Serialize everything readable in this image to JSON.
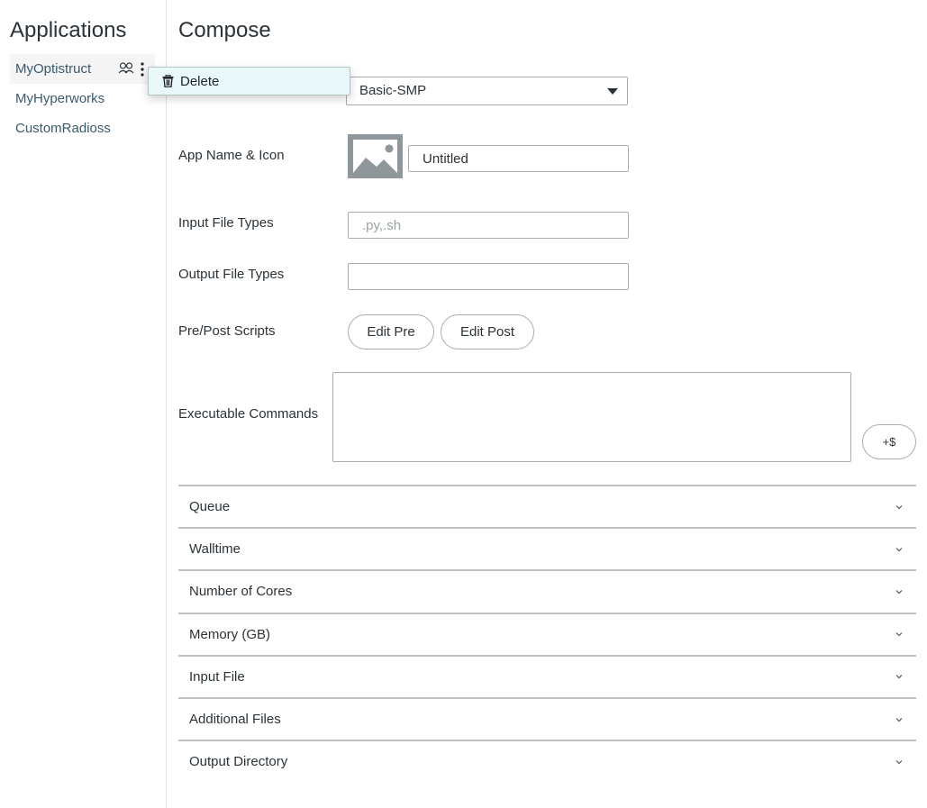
{
  "sidebar": {
    "title": "Applications",
    "apps": [
      {
        "name": "MyOptistruct",
        "active": true,
        "icons": [
          "share-users-icon",
          "kebab-menu-icon"
        ]
      },
      {
        "name": "MyHyperworks",
        "active": false
      },
      {
        "name": "CustomRadioss",
        "active": false
      }
    ]
  },
  "context_menu": {
    "items": [
      {
        "label": "Delete",
        "icon": "trash-icon"
      }
    ]
  },
  "main": {
    "title": "Compose",
    "template_select": {
      "value": "Basic-SMP"
    },
    "fields": {
      "app_name_icon": {
        "label": "App Name & Icon",
        "icon": "image-placeholder-icon",
        "value": "Untitled"
      },
      "input_file_types": {
        "label": "Input File Types",
        "value": "",
        "placeholder": ".py,.sh"
      },
      "output_file_types": {
        "label": "Output File Types",
        "value": "",
        "placeholder": ""
      },
      "pre_post_scripts": {
        "label": "Pre/Post Scripts",
        "edit_pre": "Edit Pre",
        "edit_post": "Edit Post"
      },
      "executable_commands": {
        "label": "Executable Commands",
        "value": "",
        "add_variable_button": "+$"
      }
    },
    "sections": [
      {
        "label": "Queue",
        "expanded": false
      },
      {
        "label": "Walltime",
        "expanded": false
      },
      {
        "label": "Number of Cores",
        "expanded": false
      },
      {
        "label": "Memory (GB)",
        "expanded": false
      },
      {
        "label": "Input File",
        "expanded": false
      },
      {
        "label": "Additional Files",
        "expanded": false
      },
      {
        "label": "Output Directory",
        "expanded": false
      }
    ]
  },
  "colors": {
    "link": "#3a5a6e",
    "menu_bg": "#e9f8f9",
    "border": "#a7aeb2",
    "icon_gray": "#8f979b"
  }
}
